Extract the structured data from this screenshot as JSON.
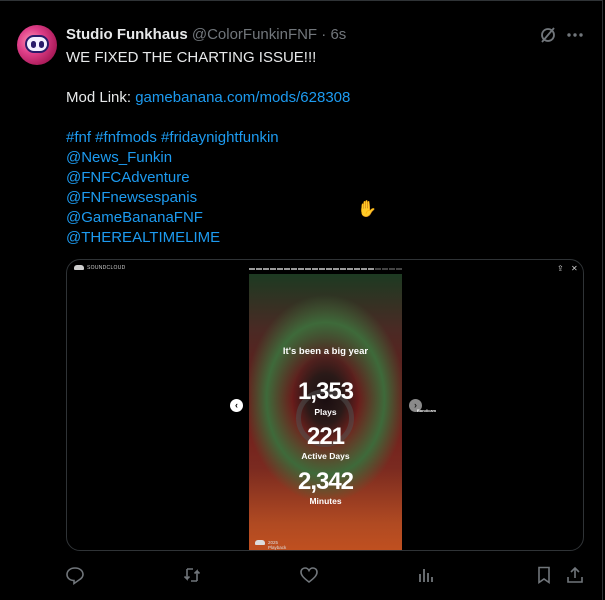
{
  "tweet": {
    "author_name": "Studio Funkhaus",
    "handle": "@ColorFunkinFNF",
    "separator": "·",
    "time": "6s",
    "lines": [
      {
        "text": "WE FIXED THE CHARTING ISSUE!!!"
      },
      {
        "text": ""
      },
      {
        "label": "Mod Link: ",
        "link": "gamebanana.com/mods/628308"
      },
      {
        "text": ""
      },
      {
        "link": "#fnf #fnfmods #fridaynightfunkin"
      },
      {
        "link": "@News_Funkin"
      },
      {
        "link": "@FNFCAdventure"
      },
      {
        "link": "@FNFnewsespanis"
      },
      {
        "link": "@GameBananaFNF"
      },
      {
        "link": "@THEREALTIMELIME"
      }
    ],
    "header_icons": [
      "grok-icon",
      "more-icon"
    ]
  },
  "media": {
    "platform_label": "SOUNDCLOUD",
    "story_title": "It's been a big year",
    "stats": [
      {
        "value": "1,353",
        "label": "Plays"
      },
      {
        "value": "221",
        "label": "Active Days"
      },
      {
        "value": "2,342",
        "label": "Minutes"
      }
    ],
    "footer_line1": "2025",
    "footer_line2": "Playback",
    "watermark": "Bandicam",
    "prev_symbol": "‹",
    "next_symbol": "›",
    "share_symbol": "⇪",
    "close_symbol": "✕"
  },
  "actions": [
    "reply-icon",
    "retweet-icon",
    "like-icon",
    "views-icon",
    "bookmark-icon",
    "share-icon"
  ],
  "colors": {
    "link": "#1d9bf0",
    "muted": "#71767b",
    "text": "#e7e9ea",
    "background": "#000000"
  }
}
